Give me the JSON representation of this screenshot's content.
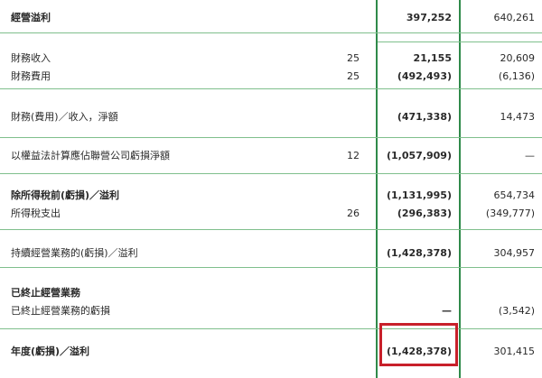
{
  "colors": {
    "rule": "#2f8a4a",
    "highlight_box": "#c8202a"
  },
  "rows": [
    {
      "label": "經營溢利",
      "note": "",
      "current": "397,252",
      "prior": "640,261"
    },
    {
      "label": "財務收入",
      "note": "25",
      "current": "21,155",
      "prior": "20,609"
    },
    {
      "label": "財務費用",
      "note": "25",
      "current": "(492,493)",
      "prior": "(6,136)"
    },
    {
      "label": "財務(費用)／收入，淨額",
      "note": "",
      "current": "(471,338)",
      "prior": "14,473"
    },
    {
      "label": "以權益法計算應佔聯營公司虧損淨額",
      "note": "12",
      "current": "(1,057,909)",
      "prior": "—"
    },
    {
      "label": "除所得稅前(虧損)／溢利",
      "note": "",
      "current": "(1,131,995)",
      "prior": "654,734"
    },
    {
      "label": "所得稅支出",
      "note": "26",
      "current": "(296,383)",
      "prior": "(349,777)"
    },
    {
      "label": "持續經營業務的(虧損)／溢利",
      "note": "",
      "current": "(1,428,378)",
      "prior": "304,957"
    },
    {
      "label": "已終止經營業務",
      "note": "",
      "current": "",
      "prior": ""
    },
    {
      "label": "已終止經營業務的虧損",
      "note": "",
      "current": "—",
      "prior": "(3,542)"
    },
    {
      "label": "年度(虧損)／溢利",
      "note": "",
      "current": "(1,428,378)",
      "prior": "301,415"
    }
  ]
}
